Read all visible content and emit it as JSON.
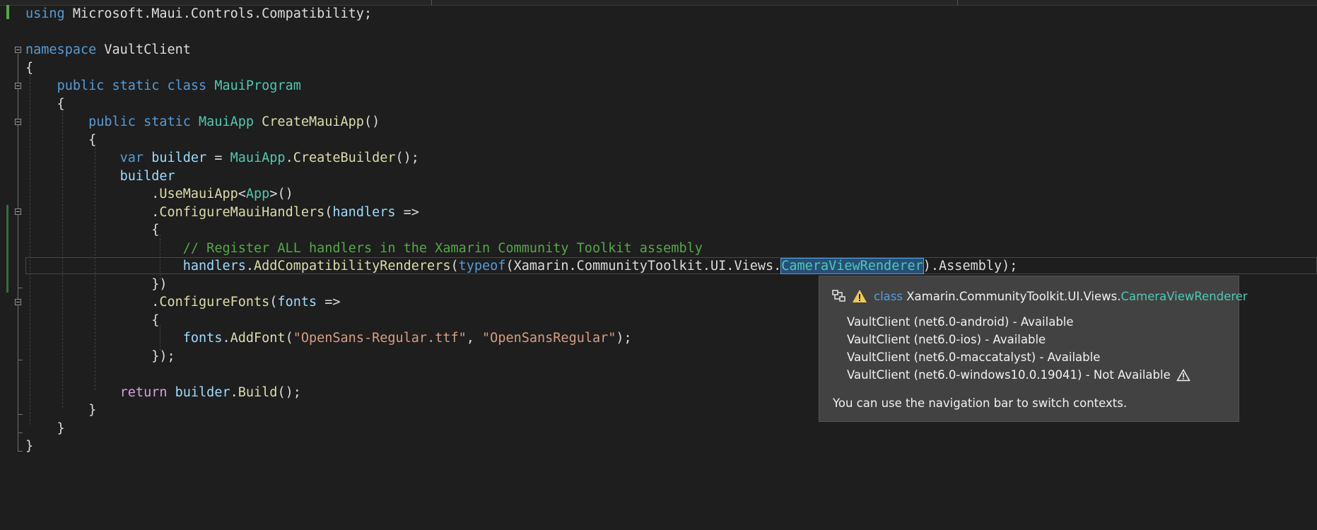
{
  "editor": {
    "lines": [
      {
        "tokens": [
          {
            "t": "using",
            "c": "kw"
          },
          {
            "t": " Microsoft.Maui.Controls.Compatibility;"
          }
        ]
      },
      {
        "tokens": []
      },
      {
        "tokens": [
          {
            "t": "namespace",
            "c": "kw"
          },
          {
            "t": " VaultClient"
          }
        ]
      },
      {
        "tokens": [
          {
            "t": "{"
          }
        ]
      },
      {
        "tokens": [
          {
            "t": "    "
          },
          {
            "t": "public",
            "c": "kw"
          },
          {
            "t": " "
          },
          {
            "t": "static",
            "c": "kw"
          },
          {
            "t": " "
          },
          {
            "t": "class",
            "c": "kw"
          },
          {
            "t": " "
          },
          {
            "t": "MauiProgram",
            "c": "ty"
          }
        ]
      },
      {
        "tokens": [
          {
            "t": "    {"
          }
        ]
      },
      {
        "tokens": [
          {
            "t": "        "
          },
          {
            "t": "public",
            "c": "kw"
          },
          {
            "t": " "
          },
          {
            "t": "static",
            "c": "kw"
          },
          {
            "t": " "
          },
          {
            "t": "MauiApp",
            "c": "ty"
          },
          {
            "t": " "
          },
          {
            "t": "CreateMauiApp",
            "c": "fn"
          },
          {
            "t": "()"
          }
        ]
      },
      {
        "tokens": [
          {
            "t": "        {"
          }
        ]
      },
      {
        "tokens": [
          {
            "t": "            "
          },
          {
            "t": "var",
            "c": "kw"
          },
          {
            "t": " "
          },
          {
            "t": "builder",
            "c": "var"
          },
          {
            "t": " = "
          },
          {
            "t": "MauiApp",
            "c": "ty"
          },
          {
            "t": "."
          },
          {
            "t": "CreateBuilder",
            "c": "fn"
          },
          {
            "t": "();"
          }
        ]
      },
      {
        "tokens": [
          {
            "t": "            "
          },
          {
            "t": "builder",
            "c": "var"
          }
        ]
      },
      {
        "tokens": [
          {
            "t": "                ."
          },
          {
            "t": "UseMauiApp",
            "c": "fn"
          },
          {
            "t": "<"
          },
          {
            "t": "App",
            "c": "ty"
          },
          {
            "t": ">()"
          }
        ]
      },
      {
        "tokens": [
          {
            "t": "                ."
          },
          {
            "t": "ConfigureMauiHandlers",
            "c": "fn"
          },
          {
            "t": "("
          },
          {
            "t": "handlers",
            "c": "var"
          },
          {
            "t": " =>"
          }
        ]
      },
      {
        "tokens": [
          {
            "t": "                {"
          }
        ]
      },
      {
        "tokens": [
          {
            "t": "                    "
          },
          {
            "t": "// Register ALL handlers in the Xamarin Community Toolkit assembly",
            "c": "cm"
          }
        ]
      },
      {
        "tokens": [
          {
            "t": "                    "
          },
          {
            "t": "handlers",
            "c": "var"
          },
          {
            "t": "."
          },
          {
            "t": "AddCompatibilityRenderers",
            "c": "fn"
          },
          {
            "t": "("
          },
          {
            "t": "typeof",
            "c": "kw"
          },
          {
            "t": "(Xamarin.CommunityToolkit.UI.Views."
          },
          {
            "t": "CameraViewRenderer",
            "c": "ty sel"
          },
          {
            "t": ").Assembly);"
          }
        ]
      },
      {
        "tokens": [
          {
            "t": "                })"
          }
        ]
      },
      {
        "tokens": [
          {
            "t": "                ."
          },
          {
            "t": "ConfigureFonts",
            "c": "fn"
          },
          {
            "t": "("
          },
          {
            "t": "fonts",
            "c": "var"
          },
          {
            "t": " =>"
          }
        ]
      },
      {
        "tokens": [
          {
            "t": "                {"
          }
        ]
      },
      {
        "tokens": [
          {
            "t": "                    "
          },
          {
            "t": "fonts",
            "c": "var"
          },
          {
            "t": "."
          },
          {
            "t": "AddFont",
            "c": "fn"
          },
          {
            "t": "("
          },
          {
            "t": "\"OpenSans-Regular.ttf\"",
            "c": "str"
          },
          {
            "t": ", "
          },
          {
            "t": "\"OpenSansRegular\"",
            "c": "str"
          },
          {
            "t": ");"
          }
        ]
      },
      {
        "tokens": [
          {
            "t": "                });"
          }
        ]
      },
      {
        "tokens": []
      },
      {
        "tokens": [
          {
            "t": "            "
          },
          {
            "t": "return",
            "c": "kw2"
          },
          {
            "t": " "
          },
          {
            "t": "builder",
            "c": "var"
          },
          {
            "t": "."
          },
          {
            "t": "Build",
            "c": "fn"
          },
          {
            "t": "();"
          }
        ]
      },
      {
        "tokens": [
          {
            "t": "        }"
          }
        ]
      },
      {
        "tokens": [
          {
            "t": "    }"
          }
        ]
      },
      {
        "tokens": [
          {
            "t": "}"
          }
        ]
      }
    ]
  },
  "quickinfo": {
    "kw": "class",
    "namespace": "Xamarin.CommunityToolkit.UI.Views.",
    "type_name": "CameraViewRenderer",
    "contexts": [
      "VaultClient (net6.0-android) - Available",
      "VaultClient (net6.0-ios) - Available",
      "VaultClient (net6.0-maccatalyst) - Available",
      "VaultClient (net6.0-windows10.0.19041) - Not Available"
    ],
    "footer": "You can use the navigation bar to switch contexts.",
    "icons": [
      "project-context-icon",
      "warning-icon"
    ]
  },
  "colors": {
    "background": "#1e1e1e",
    "keyword": "#569cd6",
    "type": "#4ec9b0",
    "method": "#dcdcaa",
    "variable": "#9cdcfe",
    "string": "#d69d85",
    "comment": "#57a64a",
    "warning": "#f2c94c"
  }
}
